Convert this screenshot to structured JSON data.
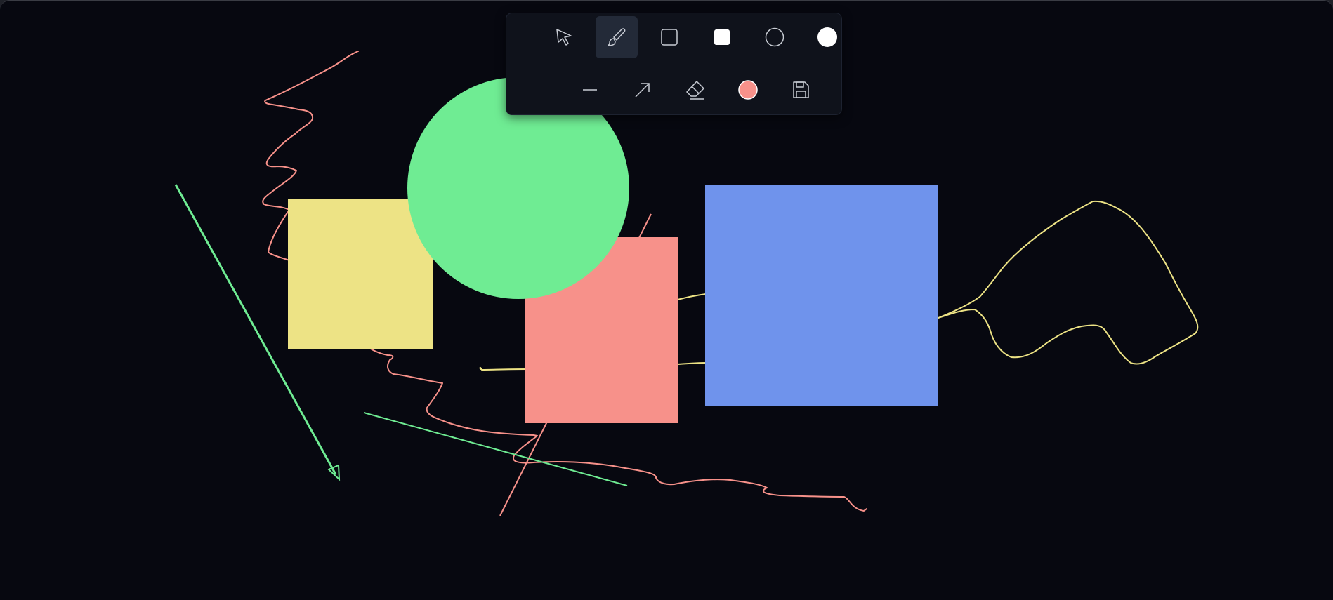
{
  "app": {
    "canvas_background": "#070810"
  },
  "toolbar": {
    "active_tool": "brush",
    "current_color": "#f7918a",
    "row1": [
      {
        "id": "select",
        "icon": "cursor-arrow-icon"
      },
      {
        "id": "brush",
        "icon": "brush-icon"
      },
      {
        "id": "rectangle",
        "icon": "rectangle-outline-icon"
      },
      {
        "id": "filled-rectangle",
        "icon": "rectangle-filled-icon"
      },
      {
        "id": "circle",
        "icon": "circle-outline-icon"
      },
      {
        "id": "filled-circle",
        "icon": "circle-filled-icon"
      }
    ],
    "row2": [
      {
        "id": "line",
        "icon": "line-icon"
      },
      {
        "id": "arrow",
        "icon": "arrow-icon"
      },
      {
        "id": "eraser",
        "icon": "eraser-icon"
      },
      {
        "id": "color-picker",
        "icon": "color-swatch-icon"
      },
      {
        "id": "save",
        "icon": "save-floppy-icon"
      }
    ]
  },
  "drawing": {
    "colors": {
      "yellow": "#ede385",
      "green": "#6fec93",
      "salmon": "#f7918a",
      "blue": "#6f93ec"
    },
    "shapes": [
      {
        "kind": "freehand",
        "color": "salmon"
      },
      {
        "kind": "freehand",
        "color": "yellow"
      },
      {
        "kind": "filled-rectangle",
        "color": "yellow"
      },
      {
        "kind": "filled-rectangle",
        "color": "salmon"
      },
      {
        "kind": "filled-rectangle",
        "color": "blue"
      },
      {
        "kind": "filled-circle",
        "color": "green"
      },
      {
        "kind": "arrow",
        "color": "green"
      },
      {
        "kind": "line",
        "color": "green"
      },
      {
        "kind": "line",
        "color": "salmon"
      }
    ]
  }
}
